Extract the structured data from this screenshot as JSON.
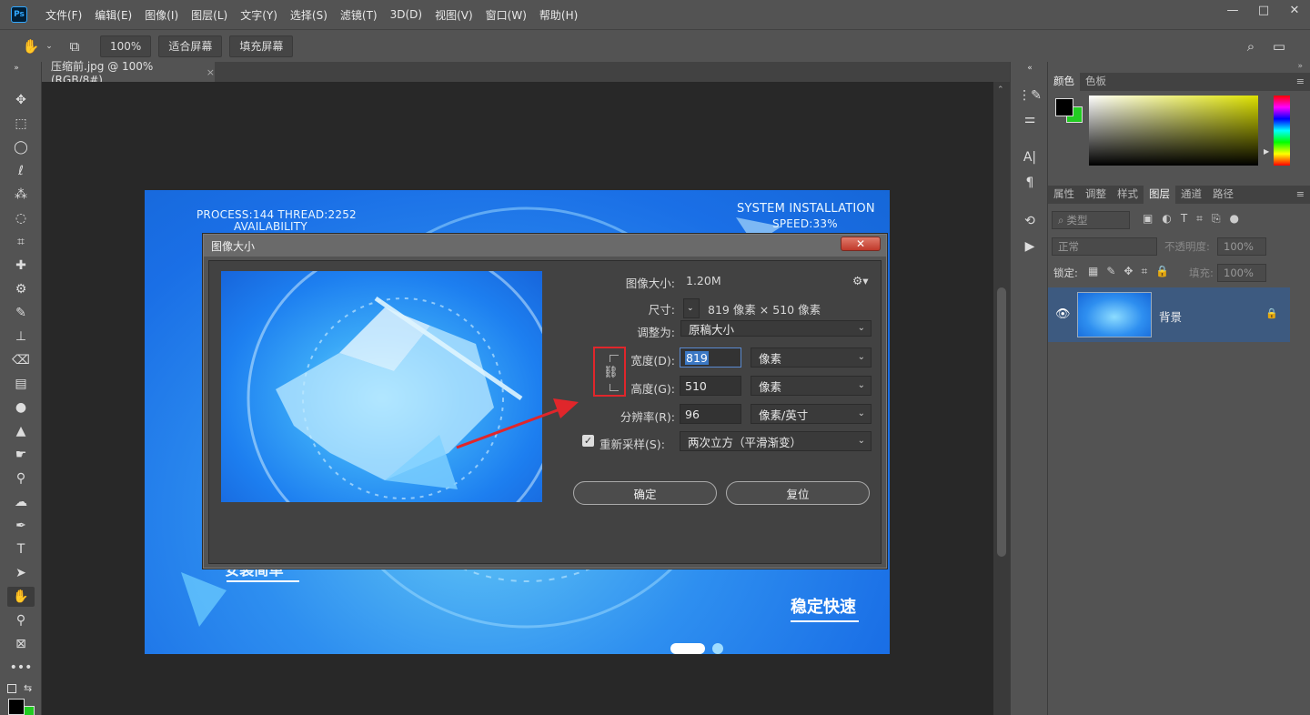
{
  "menubar": {
    "logo": "Ps",
    "items": [
      "文件(F)",
      "编辑(E)",
      "图像(I)",
      "图层(L)",
      "文字(Y)",
      "选择(S)",
      "滤镜(T)",
      "3D(D)",
      "视图(V)",
      "窗口(W)",
      "帮助(H)"
    ],
    "window_controls": [
      "—",
      "□",
      "✕"
    ]
  },
  "options": {
    "zoom": "100%",
    "fit_screen": "适合屏幕",
    "fill_screen": "填充屏幕"
  },
  "document": {
    "tab_title": "压缩前.jpg @ 100%(RGB/8#)",
    "tab_close": "×"
  },
  "artwork": {
    "line1": "PROCESS:144  THREAD:2252",
    "line2": "AVAILABILITY",
    "line3": "SYSTEM INSTALLATION",
    "line4": "SPEED:33%",
    "bottom_left": "安装简单",
    "bottom_right": "稳定快速"
  },
  "dialog": {
    "title": "图像大小",
    "close": "✕",
    "image_size_label": "图像大小:",
    "image_size_value": "1.20M",
    "dimensions_label": "尺寸:",
    "dimensions_value": "819 像素 × 510 像素",
    "fit_to_label": "调整为:",
    "fit_to_value": "原稿大小",
    "width_label": "宽度(D):",
    "width_value": "819",
    "width_unit": "像素",
    "height_label": "高度(G):",
    "height_value": "510",
    "height_unit": "像素",
    "resolution_label": "分辨率(R):",
    "resolution_value": "96",
    "resolution_unit": "像素/英寸",
    "resample_label": "重新采样(S):",
    "resample_value": "两次立方（平滑渐变）",
    "resample_checked": true,
    "ok": "确定",
    "reset": "复位"
  },
  "panels": {
    "color_tabs": [
      "颜色",
      "色板"
    ],
    "layer_tabs": [
      "属性",
      "调整",
      "样式",
      "图层",
      "通道",
      "路径"
    ],
    "filter_kind": "类型",
    "blend_mode": "正常",
    "opacity_label": "不透明度:",
    "opacity_value": "100%",
    "lock_label": "锁定:",
    "fill_label": "填充:",
    "fill_value": "100%",
    "layer_name": "背景"
  },
  "colors": {
    "foreground": "#000000",
    "background": "#22cc22",
    "accent_red": "#e0262b"
  }
}
